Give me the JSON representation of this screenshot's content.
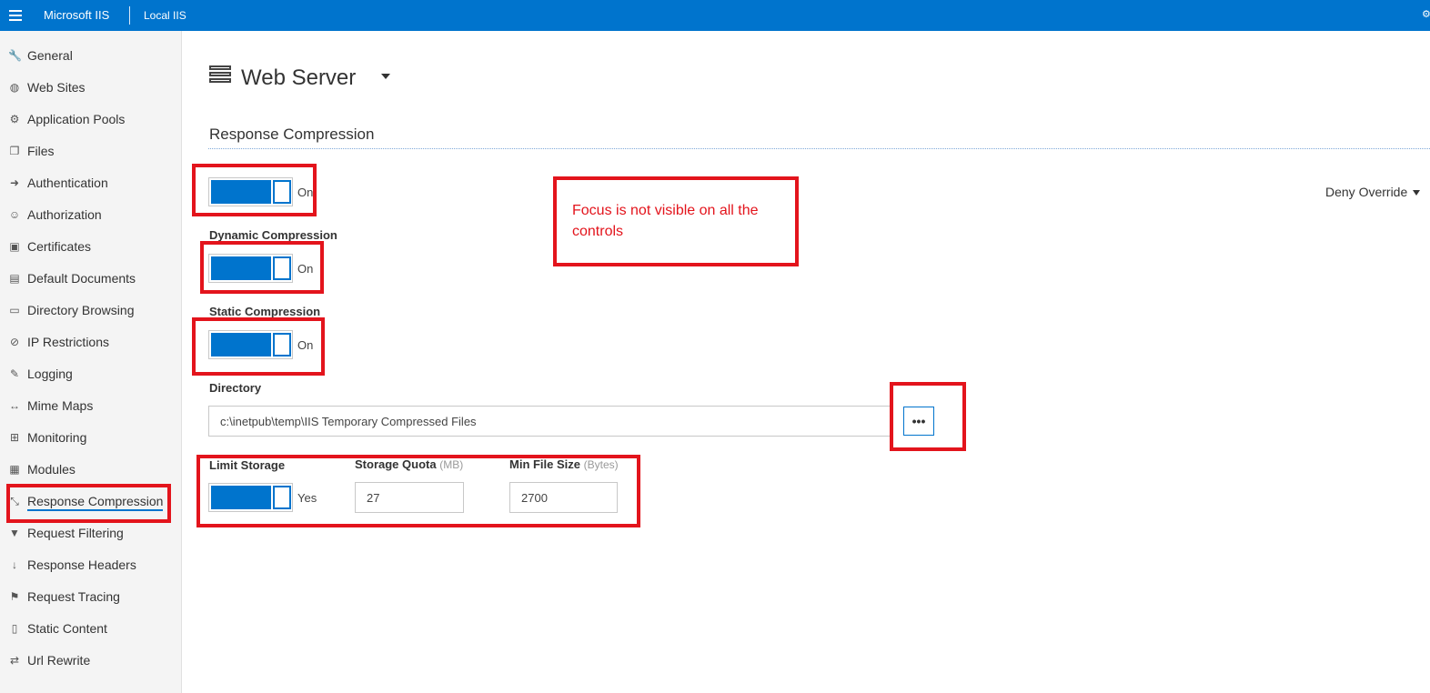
{
  "header": {
    "app_name": "Microsoft IIS",
    "breadcrumb": "Local IIS",
    "accent_color": "#0074cd"
  },
  "sidebar": {
    "items": [
      {
        "label": "General",
        "icon": "wrench-icon"
      },
      {
        "label": "Web Sites",
        "icon": "globe-icon"
      },
      {
        "label": "Application Pools",
        "icon": "gears-icon"
      },
      {
        "label": "Files",
        "icon": "files-icon"
      },
      {
        "label": "Authentication",
        "icon": "sign-in-icon"
      },
      {
        "label": "Authorization",
        "icon": "user-icon"
      },
      {
        "label": "Certificates",
        "icon": "lock-icon"
      },
      {
        "label": "Default Documents",
        "icon": "document-icon"
      },
      {
        "label": "Directory Browsing",
        "icon": "folder-open-icon"
      },
      {
        "label": "IP Restrictions",
        "icon": "ban-icon"
      },
      {
        "label": "Logging",
        "icon": "pencil-icon"
      },
      {
        "label": "Mime Maps",
        "icon": "arrows-horizontal-icon"
      },
      {
        "label": "Monitoring",
        "icon": "medkit-icon"
      },
      {
        "label": "Modules",
        "icon": "grid-icon"
      },
      {
        "label": "Response Compression",
        "icon": "compress-icon",
        "active": true
      },
      {
        "label": "Request Filtering",
        "icon": "filter-icon"
      },
      {
        "label": "Response Headers",
        "icon": "arrow-down-icon"
      },
      {
        "label": "Request Tracing",
        "icon": "flag-icon"
      },
      {
        "label": "Static Content",
        "icon": "file-icon"
      },
      {
        "label": "Url Rewrite",
        "icon": "exchange-icon"
      }
    ]
  },
  "main": {
    "title": "Web Server",
    "section_title": "Response Compression",
    "deny_override": "Deny Override",
    "enabled_toggle": {
      "state_text": "On",
      "on": true
    },
    "dynamic": {
      "label": "Dynamic Compression",
      "state_text": "On",
      "on": true
    },
    "static": {
      "label": "Static Compression",
      "state_text": "On",
      "on": true
    },
    "directory": {
      "label": "Directory",
      "value": "c:\\inetpub\\temp\\IIS Temporary Compressed Files",
      "browse_label": "•••"
    },
    "limit_storage": {
      "label": "Limit Storage",
      "state_text": "Yes",
      "on": true
    },
    "storage_quota": {
      "label": "Storage Quota",
      "unit": "(MB)",
      "value": "27"
    },
    "min_file_size": {
      "label": "Min File Size",
      "unit": "(Bytes)",
      "value": "2700"
    }
  },
  "annotation": {
    "note": "Focus is not visible on all the controls",
    "color": "#e3141c"
  }
}
